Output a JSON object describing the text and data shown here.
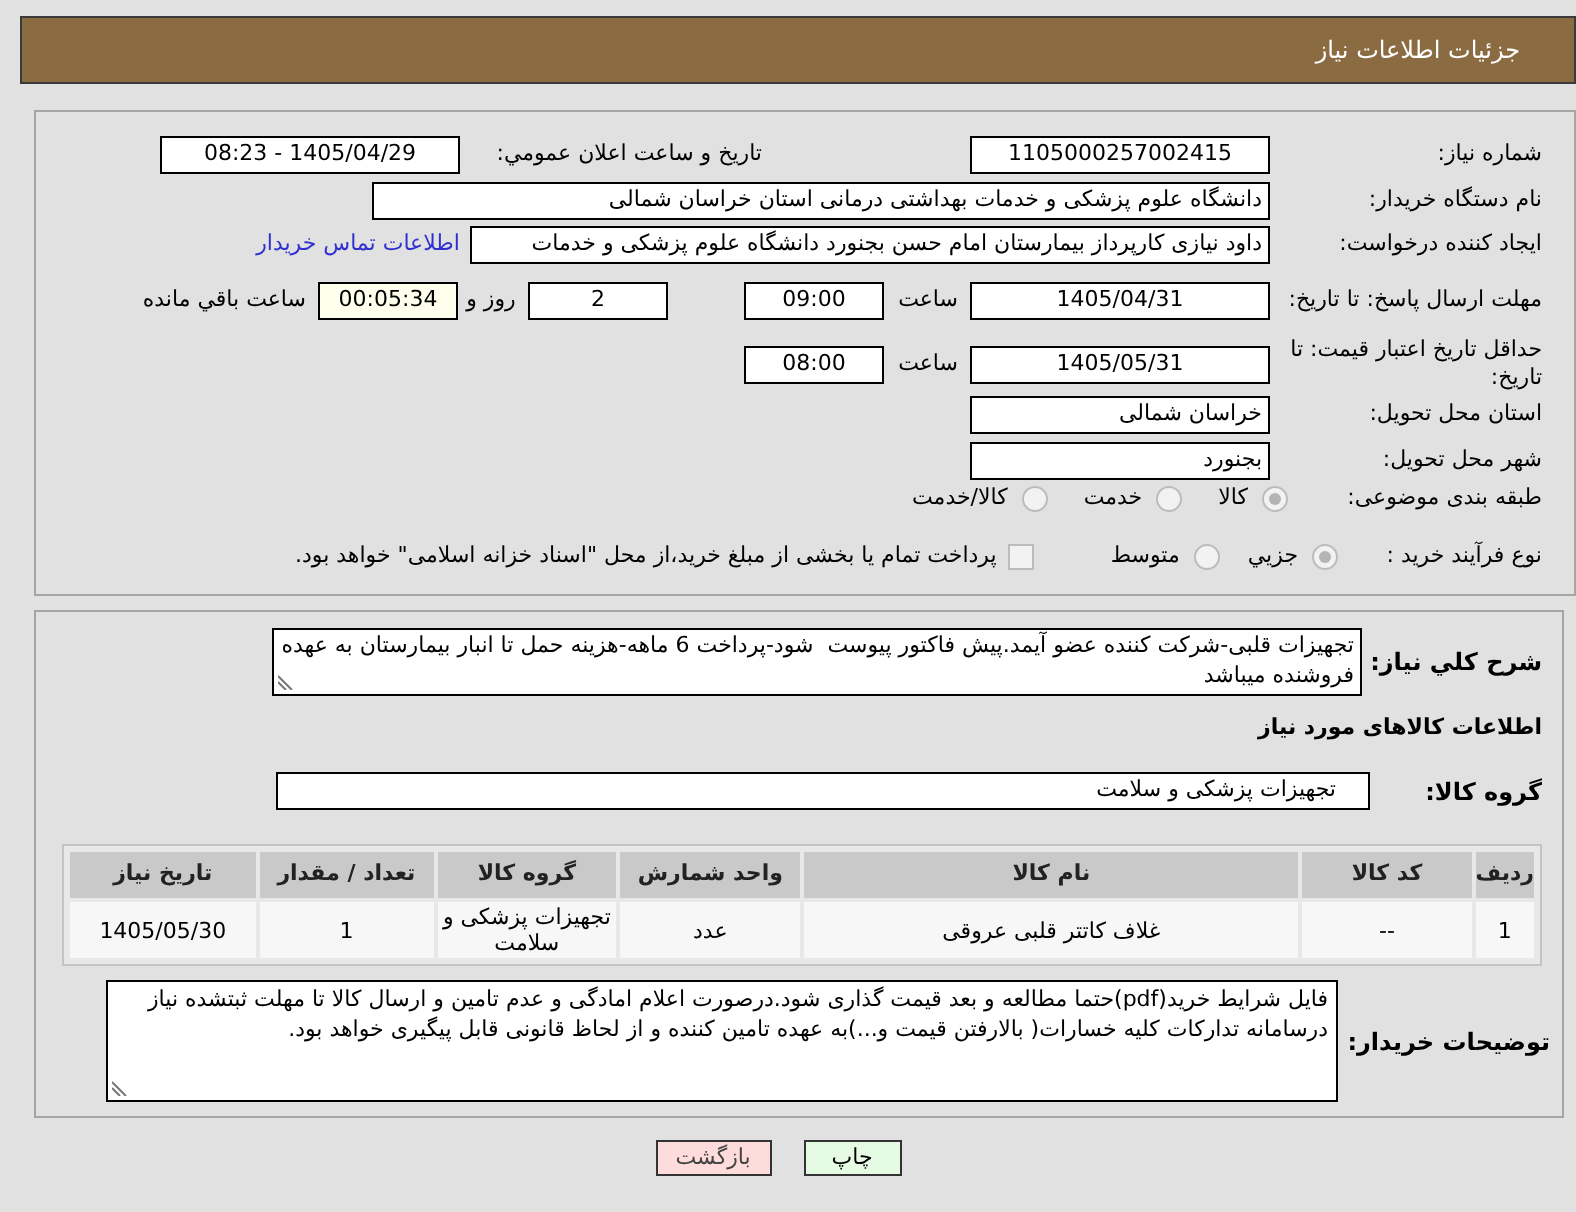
{
  "header": {
    "title": "جزئیات اطلاعات نیاز"
  },
  "details": {
    "need_number": {
      "label": "شماره نیاز:",
      "value": "1105000257002415"
    },
    "announcement": {
      "label": "تاریخ و ساعت اعلان عمومي:",
      "value": "1405/04/29 - 08:23"
    },
    "buyer_organization": {
      "label": "نام دستگاه خریدار:",
      "value": "دانشگاه علوم پزشکی و خدمات بهداشتی درمانی استان خراسان شمالی"
    },
    "requester": {
      "label": "ایجاد کننده درخواست:",
      "value": "داود نیازی کارپرداز بیمارستان امام حسن بجنورد دانشگاه علوم پزشکی و خدمات",
      "contact_link": "اطلاعات تماس خریدار"
    },
    "response_deadline": {
      "label": "مهلت ارسال پاسخ: تا تاریخ:",
      "date": "1405/04/31",
      "time_label": "ساعت",
      "time": "09:00",
      "days": "2",
      "days_label": "روز و",
      "remaining": "00:05:34",
      "remaining_label": "ساعت باقي مانده"
    },
    "price_validity": {
      "label": "حداقل تاریخ اعتبار قیمت: تا تاریخ:",
      "date": "1405/05/31",
      "time_label": "ساعت",
      "time": "08:00"
    },
    "delivery_province": {
      "label": "استان محل تحویل:",
      "value": "خراسان شمالی"
    },
    "delivery_city": {
      "label": "شهر محل تحویل:",
      "value": "بجنورد"
    },
    "subject_category": {
      "label": "طبقه بندی موضوعی:",
      "options": [
        {
          "label": "کالا",
          "selected": true,
          "disabled": true
        },
        {
          "label": "خدمت",
          "selected": false,
          "disabled": true
        },
        {
          "label": "کالا/خدمت",
          "selected": false,
          "disabled": true
        }
      ]
    },
    "purchase_process": {
      "label": "نوع فرآیند خرید :",
      "options": [
        {
          "label": "جزيي",
          "selected": true,
          "disabled": true
        },
        {
          "label": "متوسط",
          "selected": false,
          "disabled": true
        }
      ],
      "treasury_option": {
        "label": "پرداخت تمام یا بخشی از مبلغ خرید،از محل \"اسناد خزانه اسلامی\" خواهد بود.",
        "checked": false,
        "disabled": true
      }
    }
  },
  "need_summary": {
    "label": "شرح کلي نیاز:",
    "value": "تجهیزات قلبی-شرکت کننده عضو آیمد.پیش فاکتور پیوست  شود-پرداخت 6 ماهه-هزینه حمل تا انبار بیمارستان به عهده فروشنده میباشد"
  },
  "goods": {
    "title": "اطلاعات کالاهای مورد نیاز",
    "group_label": "گروه کالا:",
    "group_value": "تجهیزات پزشکی و سلامت",
    "table": {
      "columns": [
        "ردیف",
        "کد کالا",
        "نام کالا",
        "واحد شمارش",
        "گروه کالا",
        "تعداد / مقدار",
        "تاریخ نیاز"
      ],
      "rows": [
        [
          "1",
          "--",
          "غلاف کاتتر قلبی عروقی",
          "عدد",
          "تجهیزات پزشکی و سلامت",
          "1",
          "1405/05/30"
        ]
      ]
    }
  },
  "buyer_notes": {
    "label": "توضیحات خریدار:",
    "value": "فایل شرایط خرید(pdf)حتما مطالعه و بعد قیمت گذاری شود.درصورت اعلام امادگی و عدم تامین و ارسال کالا تا مهلت ثبتشده نیاز درسامانه تدارکات کلیه خسارات( بالارفتن قیمت و...)به عهده تامین کننده و از لحاظ قانونی قابل پیگیری خواهد بود."
  },
  "buttons": [
    {
      "kind": "print",
      "label": "چاپ"
    },
    {
      "kind": "back",
      "label": "بازگشت"
    }
  ]
}
